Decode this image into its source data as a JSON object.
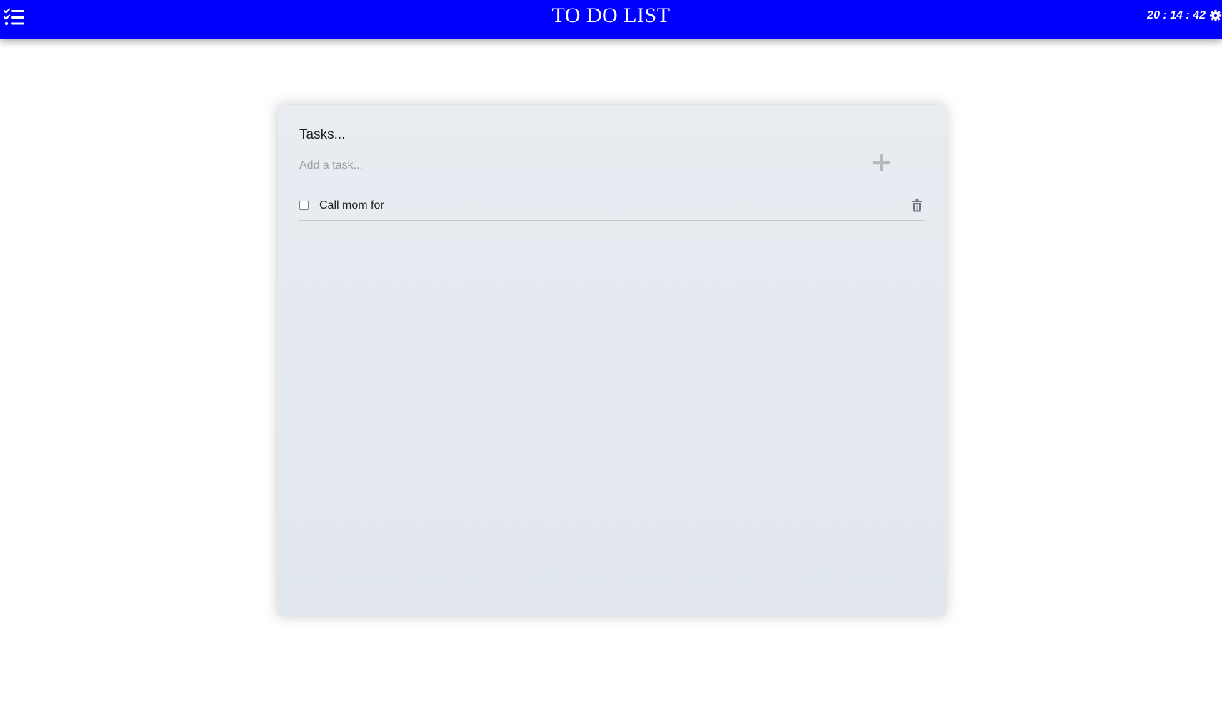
{
  "header": {
    "title": "TO DO LIST",
    "clock": "20 : 14 : 42",
    "menu_icon": "checklist-icon",
    "settings_icon": "gear-icon"
  },
  "panel": {
    "title": "Tasks...",
    "input_placeholder": "Add a task...",
    "input_value": "",
    "add_icon": "plus-icon"
  },
  "tasks": [
    {
      "label": "Call mom for",
      "checked": false,
      "delete_icon": "trash-icon"
    }
  ],
  "colors": {
    "header_bg": "#0000ff",
    "header_text": "#ffffff",
    "panel_bg": "#e7eaf0"
  }
}
